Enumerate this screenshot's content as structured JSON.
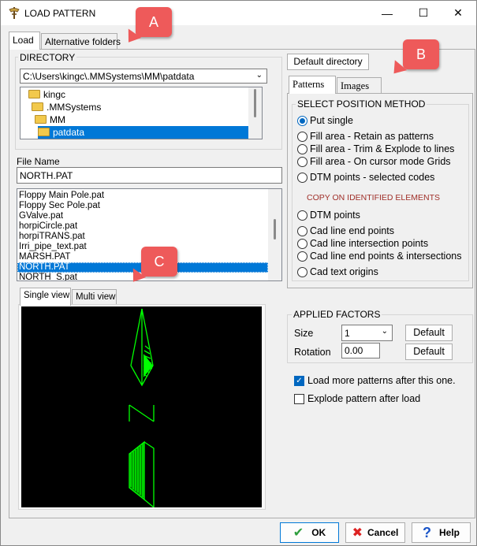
{
  "window": {
    "title": "LOAD PATTERN",
    "controls": {
      "minimize": "—",
      "maximize": "☐",
      "close": "✕"
    }
  },
  "tabs_main": [
    {
      "label": "Load",
      "active": true
    },
    {
      "label": "Alternative folders",
      "active": false
    }
  ],
  "callouts": {
    "a": "A",
    "b": "B",
    "c": "C"
  },
  "directory": {
    "label": "DIRECTORY",
    "path": "C:\\Users\\kingc\\.MMSystems\\MM\\patdata",
    "tree": [
      {
        "label": "kingc",
        "selected": false
      },
      {
        "label": ".MMSystems",
        "selected": false
      },
      {
        "label": "MM",
        "selected": false
      },
      {
        "label": "patdata",
        "selected": true
      }
    ]
  },
  "default_directory_button": "Default directory",
  "file_name": {
    "label": "File Name",
    "value": "NORTH.PAT"
  },
  "file_list": {
    "items": [
      "Floppy Main Pole.pat",
      "Floppy Sec Pole.pat",
      "GValve.pat",
      "horpiCircle.pat",
      "horpiTRANS.pat",
      "Irri_pipe_text.pat",
      "MARSH.PAT",
      "NORTH.PAT",
      "NORTH_S.pat"
    ],
    "selected": "NORTH.PAT"
  },
  "view_tabs": [
    {
      "label": "Single view",
      "active": true
    },
    {
      "label": "Multi view",
      "active": false
    }
  ],
  "right_tabs": [
    {
      "label": "Patterns",
      "active": true
    },
    {
      "label": "Images",
      "active": false
    }
  ],
  "position_method": {
    "label": "SELECT POSITION METHOD",
    "options": [
      {
        "label": "Put single",
        "checked": true
      },
      {
        "label": "Fill area - Retain as patterns",
        "checked": false
      },
      {
        "label": "Fill area - Trim & Explode to lines",
        "checked": false
      },
      {
        "label": "Fill area - On cursor mode Grids",
        "checked": false
      },
      {
        "label": "DTM points - selected codes",
        "checked": false
      }
    ],
    "copy_header": "COPY ON IDENTIFIED ELEMENTS",
    "copy_options": [
      {
        "label": "DTM points",
        "checked": false
      },
      {
        "label": "Cad line end points",
        "checked": false
      },
      {
        "label": "Cad line intersection points",
        "checked": false
      },
      {
        "label": "Cad line end points & intersections",
        "checked": false
      },
      {
        "label": "Cad text origins",
        "checked": false
      }
    ]
  },
  "applied_factors": {
    "label": "APPLIED FACTORS",
    "size_label": "Size",
    "size_value": "1",
    "rotation_label": "Rotation",
    "rotation_value": "0.00",
    "default_label": "Default"
  },
  "checkboxes": [
    {
      "label": "Load more patterns after this one.",
      "checked": true
    },
    {
      "label": "Explode pattern after load",
      "checked": false
    }
  ],
  "buttons": {
    "ok": "OK",
    "cancel": "Cancel",
    "help": "Help"
  },
  "colors": {
    "accent": "#0078d7",
    "callout": "#ee5a5a",
    "preview_bg": "#000000",
    "preview_stroke": "#00ff00",
    "copy_header": "#a0302a"
  }
}
